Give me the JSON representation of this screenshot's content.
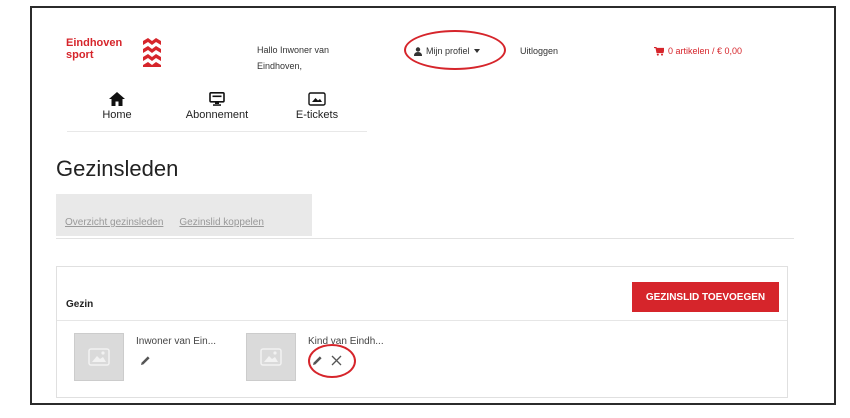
{
  "brand": {
    "line1": "Eindhoven",
    "line2": "sport",
    "color": "#d6252b"
  },
  "header": {
    "greeting_line1": "Hallo Inwoner van",
    "greeting_line2": "Eindhoven,",
    "profile_label": "Mijn profiel",
    "logout_label": "Uitloggen",
    "cart_label": "0 artikelen / € 0,00"
  },
  "nav": {
    "items": [
      {
        "label": "Home",
        "icon": "home-icon"
      },
      {
        "label": "Abonnement",
        "icon": "monitor-icon"
      },
      {
        "label": "E-tickets",
        "icon": "image-icon"
      }
    ]
  },
  "page": {
    "title": "Gezinsleden",
    "tabs": [
      {
        "label": "Overzicht gezinsleden"
      },
      {
        "label": "Gezinslid koppelen"
      }
    ]
  },
  "panel": {
    "title": "Gezin",
    "add_button": "GEZINSLID TOEVOEGEN",
    "members": [
      {
        "name": "Inwoner van Ein...",
        "actions": [
          "edit"
        ]
      },
      {
        "name": "Kind van Eindh...",
        "actions": [
          "edit",
          "remove"
        ]
      }
    ]
  },
  "colors": {
    "accent": "#d6252b",
    "tab_bg": "#e9e9e9"
  }
}
